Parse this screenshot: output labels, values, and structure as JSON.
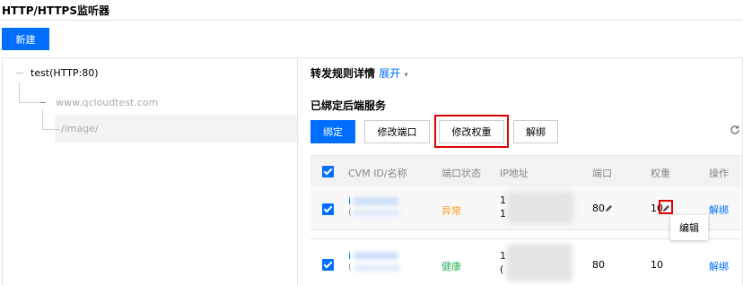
{
  "page": {
    "title": "HTTP/HTTPS监听器"
  },
  "toolbar": {
    "new_label": "新建"
  },
  "tree": {
    "listener": "test(HTTP:80)",
    "domain": "www.qcloudtest.com",
    "path": "/image/"
  },
  "detail": {
    "title": "转发规则详情",
    "expand_label": "展开",
    "expand_caret": "▾",
    "bound_title": "已绑定后端服务"
  },
  "actions": {
    "bind": "绑定",
    "edit_port": "修改端口",
    "edit_weight": "修改权重",
    "unbind": "解绑"
  },
  "table": {
    "headers": {
      "cvm": "CVM ID/名称",
      "port_status": "端口状态",
      "ip": "IP地址",
      "port": "端口",
      "weight": "权重",
      "ops": "操作"
    },
    "rows": [
      {
        "id_prefix": "i",
        "name_prefix": "(",
        "status": "异常",
        "status_color": "#ff9c19",
        "ip_line1": "1",
        "ip_line2": "1",
        "port": "80",
        "weight": "10",
        "op": "解绑"
      },
      {
        "id_prefix": "i",
        "name_prefix": "(",
        "status": "健康",
        "status_color": "#29b35a",
        "ip_line1": "1",
        "ip_line2": "(",
        "port": "80",
        "weight": "10",
        "op": "解绑"
      }
    ]
  },
  "tooltip": {
    "label": "编辑"
  },
  "colors": {
    "accent": "#006eff",
    "highlight": "#e00000"
  }
}
